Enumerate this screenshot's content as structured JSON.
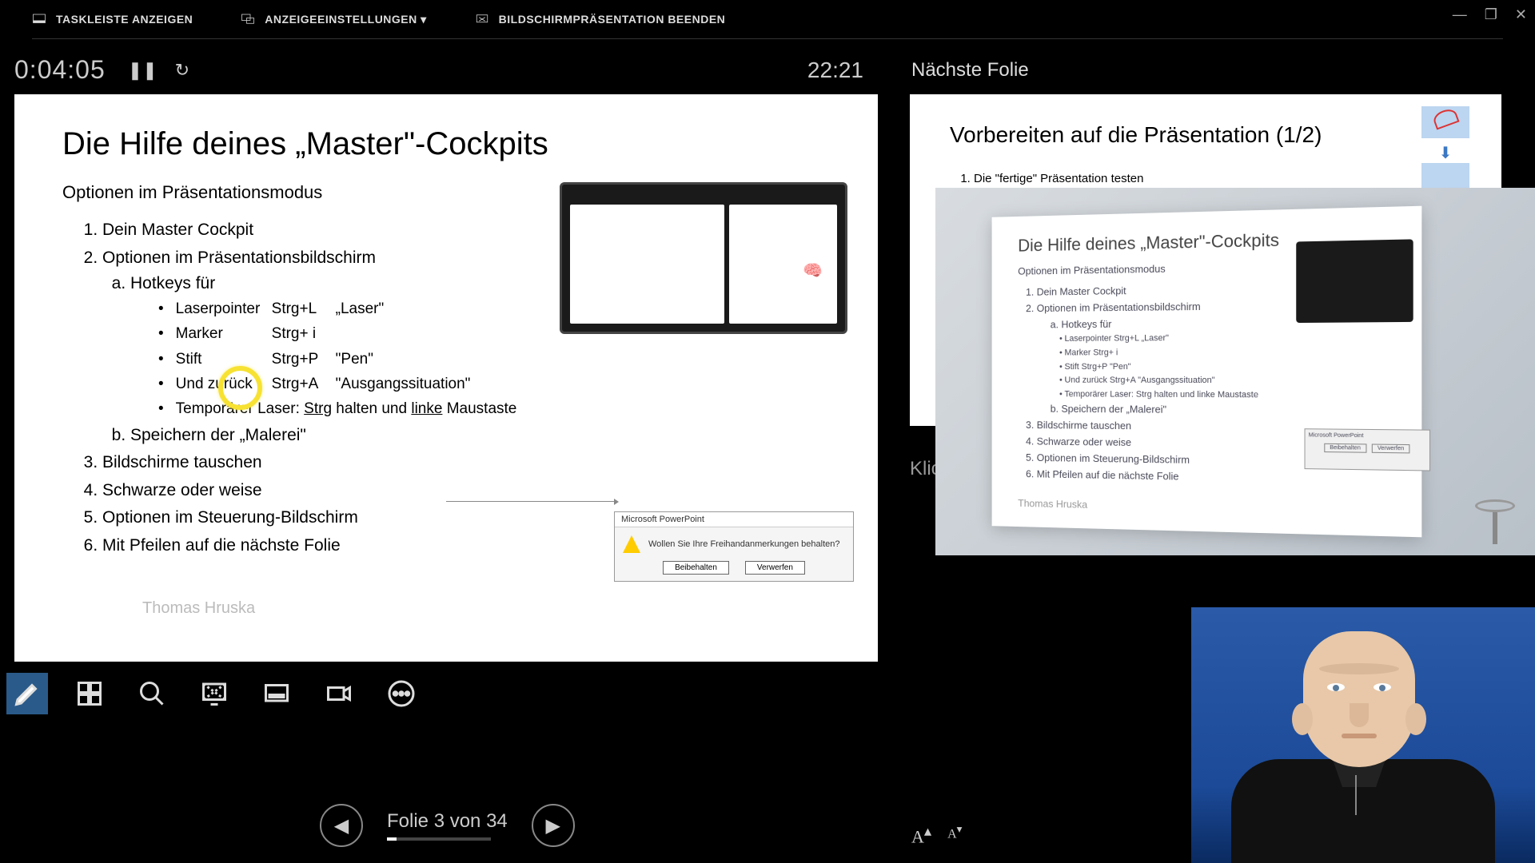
{
  "menubar": {
    "taskbar": "TASKLEISTE ANZEIGEN",
    "display": "ANZEIGEEINSTELLUNGEN ▾",
    "end": "BILDSCHIRMPRÄSENTATION BEENDEN"
  },
  "timer": {
    "elapsed": "0:04:05",
    "clock": "22:21"
  },
  "right_header": "Nächste Folie",
  "slide": {
    "title": "Die Hilfe deines „Master\"-Cockpits",
    "subtitle": "Optionen im Präsentationsmodus",
    "item1": "Dein Master Cockpit",
    "item2": "Optionen im Präsentationsbildschirm",
    "item2a": "Hotkeys für",
    "hk1_name": "Laserpointer",
    "hk1_key": "Strg+L",
    "hk1_word": "„Laser\"",
    "hk2_name": "Marker",
    "hk2_key": "Strg+ i",
    "hk2_word": "",
    "hk3_name": "Stift",
    "hk3_key": "Strg+P",
    "hk3_word": "\"Pen\"",
    "hk4_name": "Und zurück",
    "hk4_key": "Strg+A",
    "hk4_word": "\"Ausgangssituation\"",
    "hk5_pre": "Temporärer Laser:  ",
    "hk5_u1": "Strg",
    "hk5_mid": " halten und ",
    "hk5_u2": "linke",
    "hk5_post": " Maustaste",
    "item2b": "Speichern der „Malerei\"",
    "item3": "Bildschirme tauschen",
    "item4": "Schwarze oder weise",
    "item5": "Optionen im Steuerung-Bildschirm",
    "item6": "Mit Pfeilen auf die nächste Folie",
    "author": "Thomas Hruska"
  },
  "dialog": {
    "title": "Microsoft PowerPoint",
    "msg": "Wollen Sie Ihre Freihandanmerkungen behalten?",
    "keep": "Beibehalten",
    "discard": "Verwerfen"
  },
  "next": {
    "title": "Vorbereiten auf die Präsentation (1/2)",
    "line1": "Die \"fertige\" Präsentation testen"
  },
  "photo": {
    "title": "Die Hilfe deines „Master\"-Cockpits",
    "subtitle": "Optionen im Präsentationsmodus",
    "i1": "Dein Master Cockpit",
    "i2": "Optionen im Präsentationsbildschirm",
    "i2a": "a. Hotkeys für",
    "b1": "•   Laserpointer   Strg+L    „Laser\"",
    "b2": "•   Marker            Strg+ i",
    "b3": "•   Stift                Strg+P    \"Pen\"",
    "b4": "•   Und zurück     Strg+A    \"Ausgangssituation\"",
    "b5": "•   Temporärer Laser:  Strg halten und linke Maustaste",
    "i2b": "b. Speichern der „Malerei\"",
    "i3": "Bildschirme tauschen",
    "i4": "Schwarze oder weise",
    "i5": "Optionen im Steuerung-Bildschirm",
    "i6": "Mit Pfeilen auf die nächste Folie",
    "author": "Thomas Hruska",
    "dlg_title": "Microsoft PowerPoint",
    "dlg_keep": "Beibehalten",
    "dlg_discard": "Verwerfen"
  },
  "notes_placeholder": "Klic",
  "nav": {
    "label": "Folie 3 von 34"
  }
}
